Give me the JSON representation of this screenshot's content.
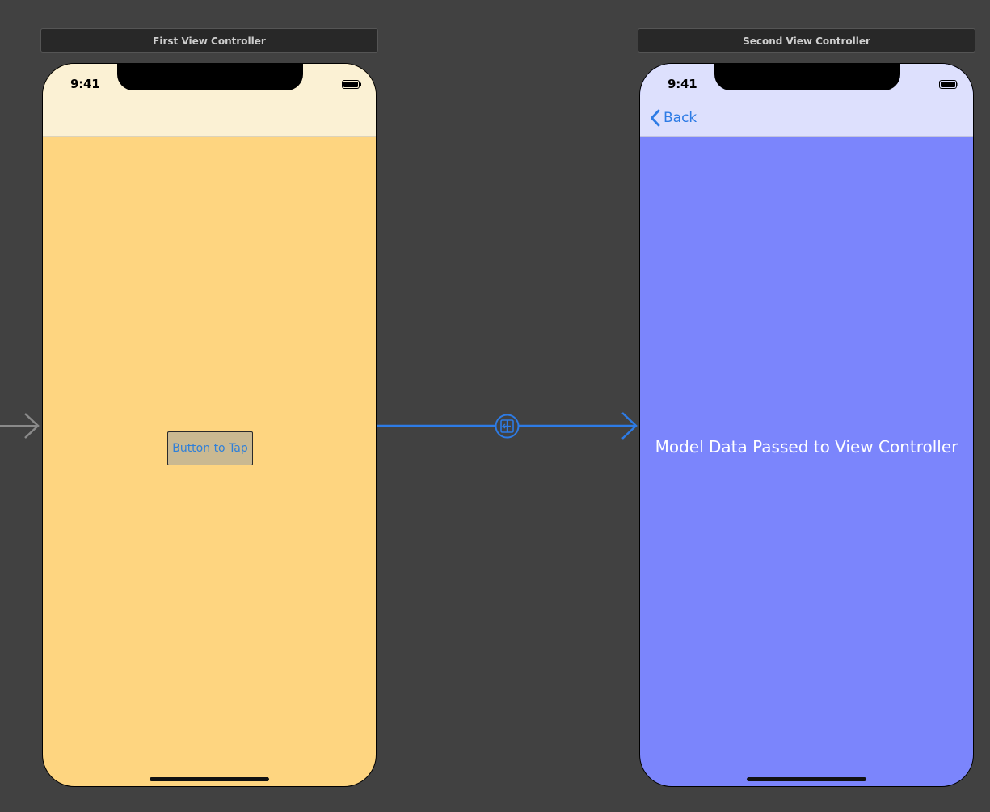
{
  "canvas": {
    "background": "#414141"
  },
  "scenes": [
    {
      "title": "First View Controller",
      "status_time": "9:41",
      "background": "#FED580",
      "nav_background": "#FBF1D4",
      "button_label": "Button to Tap",
      "button_text_color": "#2E7FD9"
    },
    {
      "title": "Second View Controller",
      "status_time": "9:41",
      "background": "#7B85FC",
      "nav_background": "#DDE0FD",
      "back_label": "Back",
      "center_label": "Model Data Passed to View Controller",
      "tint_color": "#2D7BE5"
    }
  ],
  "connections": {
    "entry_arrow_icon": "initial-view-controller-arrow",
    "segue_icon": "segue-push-icon",
    "segue_color": "#2D7BE5"
  }
}
